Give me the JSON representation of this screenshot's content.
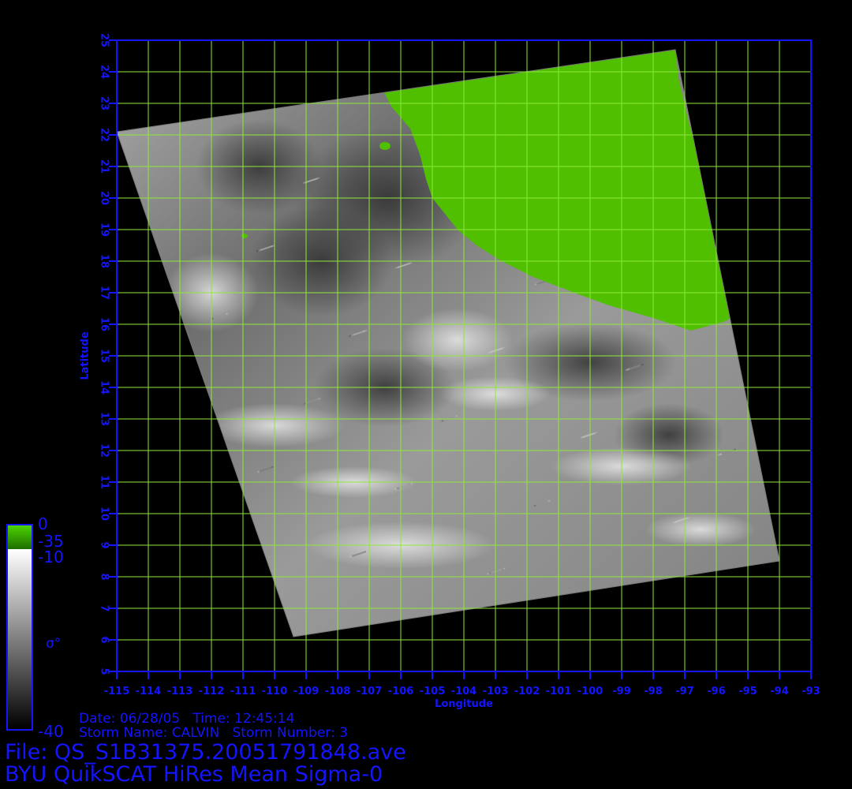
{
  "map": {
    "lon_min": -115,
    "lon_max": -93,
    "lat_min": 5,
    "lat_max": 25,
    "lon_ticks": [
      "-115",
      "-114",
      "-113",
      "-112",
      "-111",
      "-110",
      "-109",
      "-108",
      "-107",
      "-106",
      "-105",
      "-104",
      "-103",
      "-102",
      "-101",
      "-100",
      "-99",
      "-98",
      "-97",
      "-96",
      "-95",
      "-94",
      "-93"
    ],
    "lat_ticks": [
      "5",
      "6",
      "7",
      "8",
      "9",
      "10",
      "11",
      "12",
      "13",
      "14",
      "15",
      "16",
      "17",
      "18",
      "19",
      "20",
      "21",
      "22",
      "23",
      "24",
      "25"
    ],
    "xlabel": "Longitude",
    "ylabel": "Latitude",
    "grid_color": "#8ee83a",
    "axis_color": "#1414ff",
    "land_color": "#4fbf00",
    "swath_corners_lonlat": [
      [
        -115,
        22.1
      ],
      [
        -109.4,
        6.1
      ],
      [
        -94,
        8.5
      ],
      [
        -97.3,
        24.7
      ]
    ],
    "coast_lonlat": [
      [
        -106.6,
        23.5
      ],
      [
        -106.3,
        22.9
      ],
      [
        -105.7,
        22.2
      ],
      [
        -105.4,
        21.4
      ],
      [
        -105.2,
        20.6
      ],
      [
        -105.0,
        20.0
      ],
      [
        -104.6,
        19.5
      ],
      [
        -104.2,
        19.0
      ],
      [
        -103.6,
        18.5
      ],
      [
        -102.8,
        18.0
      ],
      [
        -101.8,
        17.5
      ],
      [
        -100.5,
        17.0
      ],
      [
        -99.4,
        16.6
      ],
      [
        -98.0,
        16.2
      ],
      [
        -96.8,
        15.8
      ],
      [
        -95.7,
        16.1
      ],
      [
        -95.4,
        16.3
      ],
      [
        -95.6,
        17.5
      ],
      [
        -96.1,
        19.5
      ],
      [
        -96.5,
        21.0
      ],
      [
        -96.9,
        22.5
      ],
      [
        -97.2,
        23.8
      ],
      [
        -97.3,
        24.7
      ]
    ]
  },
  "legend": {
    "labels": [
      "0",
      "-35",
      "-10",
      "-40"
    ],
    "symbol": "σ°",
    "green_range": [
      0,
      -35
    ],
    "gray_range": [
      -10,
      -40
    ]
  },
  "info": {
    "date_time": "Date: 06/28/05   Time: 12:45:14",
    "storm": "Storm Name: CALVIN   Storm Number: 3",
    "file": "File: QS_S1B31375.20051791848.ave",
    "title": "BYU QuikSCAT HiRes Mean Sigma-0"
  }
}
